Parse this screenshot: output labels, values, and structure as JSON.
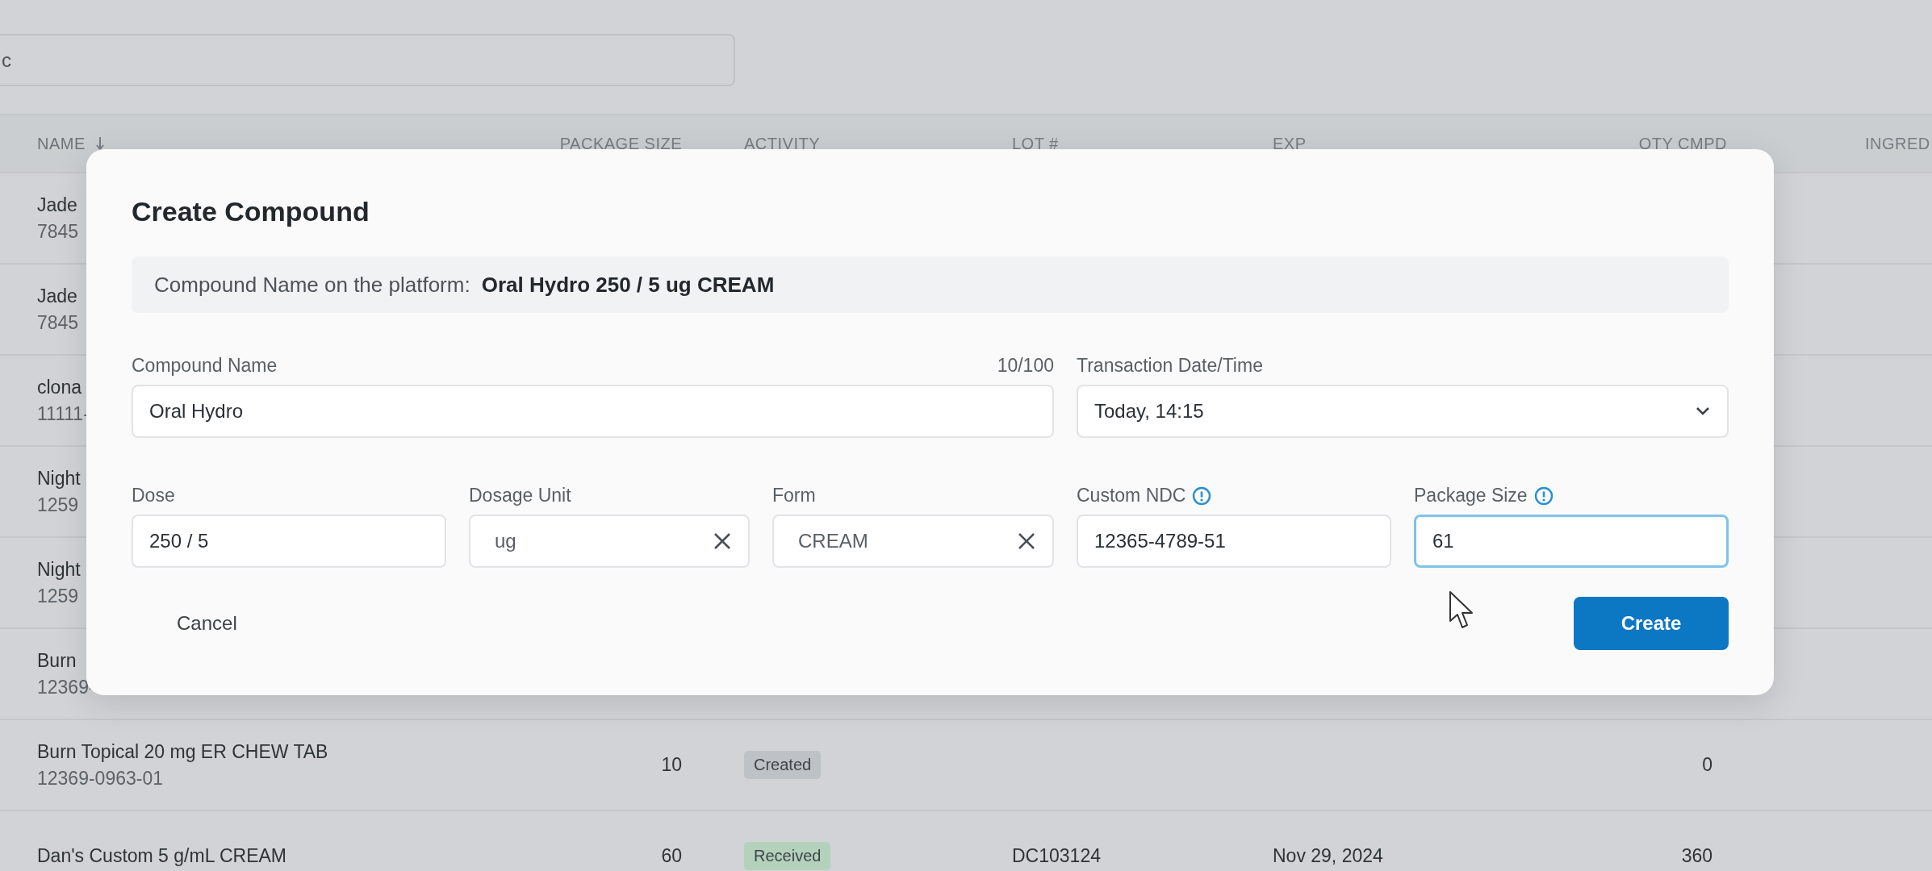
{
  "search": {
    "value": "c"
  },
  "table": {
    "columns": [
      {
        "label": "NAME",
        "sorted": true
      },
      {
        "label": "PACKAGE SIZE",
        "sorted": false
      },
      {
        "label": "ACTIVITY",
        "sorted": false
      },
      {
        "label": "LOT #",
        "sorted": false
      },
      {
        "label": "EXP",
        "sorted": false
      },
      {
        "label": "QTY CMPD",
        "sorted": false
      },
      {
        "label": "INGRED"
      }
    ],
    "rows": [
      {
        "name": "Jade",
        "code": "7845"
      },
      {
        "name": "Jade",
        "code": "7845"
      },
      {
        "name": "clona",
        "code": "11111-"
      },
      {
        "name": "Night",
        "code": "1259"
      },
      {
        "name": "Night",
        "code": "1259"
      },
      {
        "name": "Burn",
        "code": "12369-"
      },
      {
        "name": "Burn Topical 20 mg ER CHEW TAB",
        "code": "12369-0963-01",
        "package_size": "10",
        "activity": {
          "label": "Created",
          "color": "#bec2c6"
        },
        "qty": "0"
      },
      {
        "name": "Dan's Custom 5 g/mL CREAM",
        "package_size": "60",
        "activity": {
          "label": "Received",
          "color": "#b4d2bb"
        },
        "lot": "DC103124",
        "exp": "Nov 29, 2024",
        "qty": "360"
      }
    ]
  },
  "dialog": {
    "title": "Create Compound",
    "preview_label": "Compound Name on the platform:",
    "preview_value": "Oral Hydro 250 / 5 ug CREAM",
    "fields": [
      {
        "kind": "text",
        "label": "Compound Name",
        "counter": "10/100",
        "value": "Oral Hydro",
        "info": false,
        "focused": false
      },
      {
        "kind": "select",
        "label": "Transaction Date/Time",
        "value": "Today, 14:15",
        "info": false,
        "focused": false
      },
      {
        "kind": "text",
        "label": "Dose",
        "value": "250 / 5",
        "info": false,
        "focused": false
      },
      {
        "kind": "clearable",
        "label": "Dosage Unit",
        "value": "ug",
        "info": false,
        "focused": false
      },
      {
        "kind": "clearable",
        "label": "Form",
        "value": "CREAM",
        "info": false,
        "focused": false
      },
      {
        "kind": "text",
        "label": "Custom NDC",
        "value": "12365-4789-51",
        "info": true,
        "focused": false
      },
      {
        "kind": "text",
        "label": "Package Size",
        "value": "61",
        "info": true,
        "focused": true
      }
    ],
    "buttons": [
      {
        "kind": "secondary",
        "label": "Cancel"
      },
      {
        "kind": "primary",
        "label": "Create"
      }
    ]
  }
}
